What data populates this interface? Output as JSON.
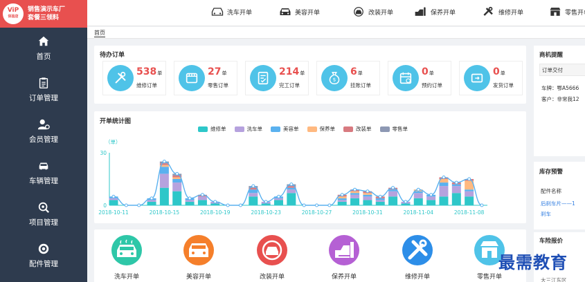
{
  "brand": {
    "logo_text": "ViP",
    "logo_sub": "体验店",
    "title_line1": "销售演示车厂",
    "title_line2": "套餐三领料"
  },
  "sidebar": {
    "items": [
      {
        "label": "首页",
        "icon": "home-icon"
      },
      {
        "label": "订单管理",
        "icon": "clipboard-icon"
      },
      {
        "label": "会员管理",
        "icon": "member-icon"
      },
      {
        "label": "车辆管理",
        "icon": "car-icon"
      },
      {
        "label": "项目管理",
        "icon": "project-icon"
      },
      {
        "label": "配件管理",
        "icon": "parts-icon"
      }
    ]
  },
  "topbar": {
    "items": [
      {
        "label": "洗车开单",
        "icon": "car-wash-icon"
      },
      {
        "label": "美容开单",
        "icon": "car-beauty-icon"
      },
      {
        "label": "改装开单",
        "icon": "modify-icon"
      },
      {
        "label": "保养开单",
        "icon": "maintenance-icon"
      },
      {
        "label": "维修开单",
        "icon": "wrench-icon"
      },
      {
        "label": "零售开单",
        "icon": "shop-icon"
      }
    ]
  },
  "breadcrumb": "首页",
  "pending": {
    "title": "待办订单",
    "stats": [
      {
        "num": "538",
        "unit": "单",
        "label": "维修订单",
        "icon": "tools-icon"
      },
      {
        "num": "27",
        "unit": "单",
        "label": "零售订单",
        "icon": "store-icon"
      },
      {
        "num": "214",
        "unit": "单",
        "label": "完工订单",
        "icon": "done-doc-icon"
      },
      {
        "num": "6",
        "unit": "单",
        "label": "挂账订单",
        "icon": "money-bag-icon"
      },
      {
        "num": "0",
        "unit": "单",
        "label": "预约订单",
        "icon": "calendar-icon"
      },
      {
        "num": "0",
        "unit": "单",
        "label": "发货订单",
        "icon": "ship-icon"
      }
    ]
  },
  "stats_chart": {
    "title": "开单统计图"
  },
  "chart_data": {
    "type": "bar",
    "stacked": true,
    "ylabel": "（单）",
    "ylim": [
      0,
      30
    ],
    "yticks": [
      0,
      30
    ],
    "xtick_labels": [
      "2018-10-11",
      "2018-10-15",
      "2018-10-19",
      "2018-10-23",
      "2018-10-27",
      "2018-10-31",
      "2018-11-04",
      "2018-11-08"
    ],
    "categories": [
      "2018-10-11",
      "2018-10-12",
      "2018-10-13",
      "2018-10-14",
      "2018-10-15",
      "2018-10-16",
      "2018-10-17",
      "2018-10-18",
      "2018-10-19",
      "2018-10-20",
      "2018-10-21",
      "2018-10-22",
      "2018-10-23",
      "2018-10-24",
      "2018-10-25",
      "2018-10-26",
      "2018-10-27",
      "2018-10-28",
      "2018-10-29",
      "2018-10-30",
      "2018-10-31",
      "2018-11-01",
      "2018-11-02",
      "2018-11-03",
      "2018-11-04",
      "2018-11-05",
      "2018-11-06",
      "2018-11-07",
      "2018-11-08",
      "2018-11-09"
    ],
    "series": [
      {
        "name": "维修单",
        "color": "#2ec7c9",
        "values": [
          3,
          0,
          0,
          2,
          10,
          8,
          2,
          3,
          1,
          0,
          0,
          5,
          1,
          3,
          7,
          0,
          0,
          0,
          2,
          4,
          3,
          2,
          5,
          1,
          4,
          3,
          5,
          7,
          5,
          0
        ]
      },
      {
        "name": "洗车单",
        "color": "#b6a2de",
        "values": [
          1,
          0,
          0,
          1,
          8,
          5,
          1,
          2,
          1,
          0,
          0,
          2,
          1,
          1,
          2,
          0,
          0,
          0,
          1,
          2,
          2,
          1,
          3,
          1,
          3,
          2,
          6,
          4,
          3,
          0
        ]
      },
      {
        "name": "美容单",
        "color": "#5ab1ef",
        "values": [
          1,
          0,
          0,
          1,
          4,
          2,
          1,
          0,
          0,
          0,
          0,
          2,
          0,
          1,
          1,
          0,
          0,
          0,
          1,
          1,
          1,
          1,
          1,
          0,
          1,
          1,
          2,
          1,
          1,
          0
        ]
      },
      {
        "name": "保养单",
        "color": "#ffb980",
        "values": [
          0,
          0,
          0,
          0,
          1,
          1,
          0,
          0,
          0,
          0,
          0,
          0,
          0,
          0,
          0,
          0,
          0,
          0,
          1,
          1,
          1,
          0,
          0,
          0,
          1,
          0,
          2,
          0,
          5,
          0
        ]
      },
      {
        "name": "改装单",
        "color": "#d87a80",
        "values": [
          0,
          0,
          0,
          0,
          1,
          1,
          0,
          1,
          0,
          0,
          0,
          1,
          0,
          0,
          1,
          0,
          0,
          0,
          1,
          1,
          1,
          1,
          1,
          0,
          0,
          0,
          1,
          1,
          1,
          0
        ]
      },
      {
        "name": "零售单",
        "color": "#8d98b3",
        "values": [
          0,
          0,
          0,
          0,
          1,
          1,
          0,
          0,
          0,
          0,
          0,
          1,
          0,
          0,
          1,
          0,
          0,
          0,
          0,
          0,
          0,
          0,
          0,
          0,
          0,
          0,
          0,
          0,
          0,
          0
        ]
      }
    ]
  },
  "quick_actions": [
    {
      "label": "洗车开单",
      "icon": "car-wash-icon",
      "color": "#2ec7a8"
    },
    {
      "label": "美容开单",
      "icon": "car-beauty-icon",
      "color": "#f57f2b"
    },
    {
      "label": "改装开单",
      "icon": "modify-icon",
      "color": "#e8504f"
    },
    {
      "label": "保养开单",
      "icon": "maintenance-icon",
      "color": "#b560d4"
    },
    {
      "label": "维修开单",
      "icon": "wrench-icon",
      "color": "#2d8ee8"
    },
    {
      "label": "零售开单",
      "icon": "shop-icon",
      "color": "#4fc3e8"
    }
  ],
  "right": {
    "opportunity": {
      "title": "商机提醒",
      "tab": "订单交付",
      "line1": "车牌：鄂A5666",
      "line2": "客户：非常我12"
    },
    "inventory": {
      "title": "库存预警",
      "col": "配件名称",
      "item": "后刹车片——1",
      "more": "刹车"
    },
    "insurance": {
      "title": "车险报价",
      "line": "大三江东区"
    }
  },
  "watermark": "最需教育",
  "colors": {
    "brand": "#e8504f",
    "sidebar": "#2e3b4e",
    "stat_circle": "#4fc3e8",
    "stat_number": "#e8504f"
  }
}
